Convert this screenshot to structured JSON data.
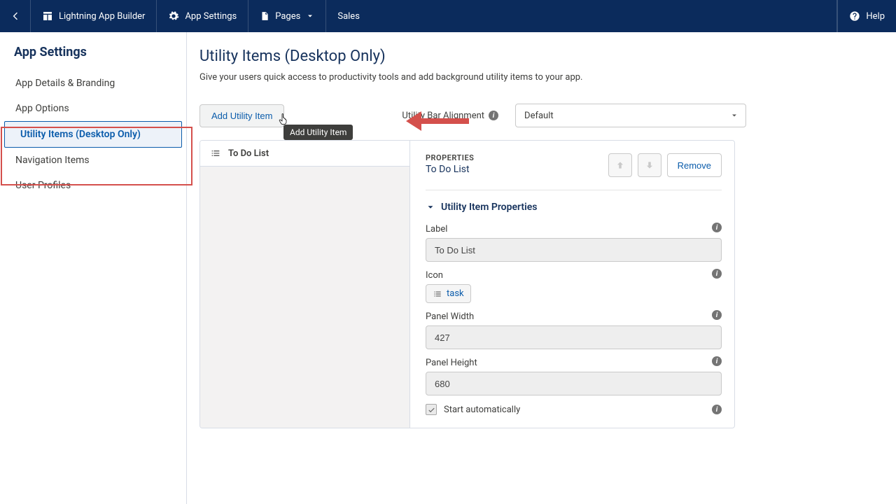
{
  "topbar": {
    "app_builder": "Lightning App Builder",
    "app_settings": "App Settings",
    "pages": "Pages",
    "sales": "Sales",
    "help": "Help"
  },
  "sidebar": {
    "title": "App Settings",
    "items": [
      {
        "label": "App Details & Branding"
      },
      {
        "label": "App Options"
      },
      {
        "label": "Utility Items (Desktop Only)"
      },
      {
        "label": "Navigation Items"
      },
      {
        "label": "User Profiles"
      }
    ],
    "selected_index": 2
  },
  "page": {
    "title": "Utility Items (Desktop Only)",
    "subtitle": "Give your users quick access to productivity tools and add background utility items to your app."
  },
  "actions": {
    "add_utility_item": "Add Utility Item",
    "tooltip": "Add Utility Item",
    "util_align_label": "Utility Bar Alignment",
    "util_align_value": "Default"
  },
  "item_list": {
    "items": [
      {
        "label": "To Do List"
      }
    ]
  },
  "properties": {
    "heading": "PROPERTIES",
    "name": "To Do List",
    "remove": "Remove",
    "section_title": "Utility Item Properties",
    "fields": {
      "label_lbl": "Label",
      "label_val": "To Do List",
      "icon_lbl": "Icon",
      "icon_val": "task",
      "panel_width_lbl": "Panel Width",
      "panel_width_val": "427",
      "panel_height_lbl": "Panel Height",
      "panel_height_val": "680",
      "start_auto_lbl": "Start automatically",
      "start_auto_checked": true
    }
  },
  "colors": {
    "brand": "#0b2b5c",
    "annotation": "#d4504c"
  }
}
